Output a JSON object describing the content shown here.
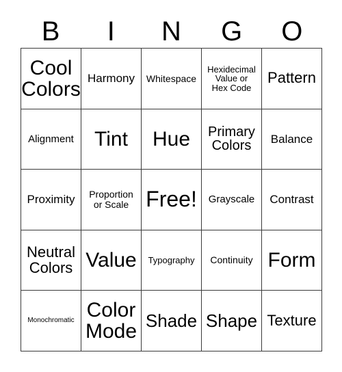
{
  "card": {
    "header_letters": [
      "B",
      "I",
      "N",
      "G",
      "O"
    ],
    "rows": [
      [
        {
          "text": "Cool\nColors",
          "size": "sz-xxl"
        },
        {
          "text": "Harmony",
          "size": "sz-md2"
        },
        {
          "text": "Whitespace",
          "size": "sz-sm2"
        },
        {
          "text": "Hexidecimal\nValue or\nHex Code",
          "size": "sz-sm"
        },
        {
          "text": "Pattern",
          "size": "sz-lg2"
        }
      ],
      [
        {
          "text": "Alignment",
          "size": "sz-md"
        },
        {
          "text": "Tint",
          "size": "sz-xxl"
        },
        {
          "text": "Hue",
          "size": "sz-xxl"
        },
        {
          "text": "Primary\nColors",
          "size": "sz-lg"
        },
        {
          "text": "Balance",
          "size": "sz-md2"
        }
      ],
      [
        {
          "text": "Proximity",
          "size": "sz-md2"
        },
        {
          "text": "Proportion\nor Scale",
          "size": "sz-sm2"
        },
        {
          "text": "Free!",
          "size": "sz-free"
        },
        {
          "text": "Grayscale",
          "size": "sz-md"
        },
        {
          "text": "Contrast",
          "size": "sz-md2"
        }
      ],
      [
        {
          "text": "Neutral\nColors",
          "size": "sz-lg2"
        },
        {
          "text": "Value",
          "size": "sz-xxl"
        },
        {
          "text": "Typography",
          "size": "sz-sm"
        },
        {
          "text": "Continuity",
          "size": "sz-sm2"
        },
        {
          "text": "Form",
          "size": "sz-xxl"
        }
      ],
      [
        {
          "text": "Monochromatic",
          "size": "sz-xs"
        },
        {
          "text": "Color\nMode",
          "size": "sz-xxl"
        },
        {
          "text": "Shade",
          "size": "sz-xl"
        },
        {
          "text": "Shape",
          "size": "sz-xl"
        },
        {
          "text": "Texture",
          "size": "sz-lg2"
        }
      ]
    ]
  },
  "colors": {
    "background": "#ffffff",
    "border": "#3a3a3a",
    "text": "#000000"
  }
}
